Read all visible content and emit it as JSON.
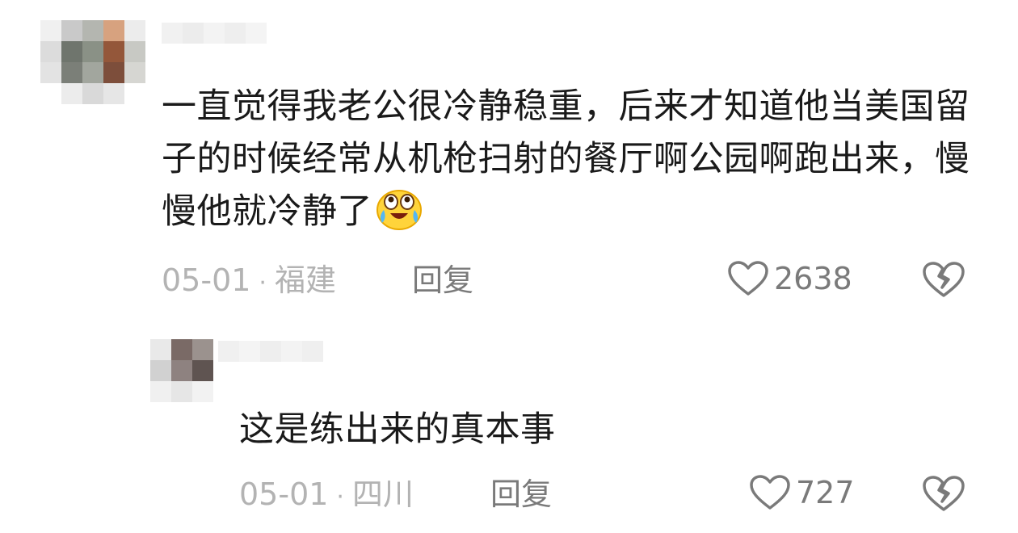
{
  "colors": {
    "text": "#1a1a1a",
    "meta": "#b3b3b3",
    "action": "#7a7a7a"
  },
  "comments": [
    {
      "text": "一直觉得我老公很冷静稳重，后来才知道他当美国留子的时候经常从机枪扫射的餐厅啊公园啊跑出来，慢慢他就冷静了",
      "emoji": "laugh-cry-emoji",
      "date": "05-01",
      "location": "福建",
      "reply_label": "回复",
      "likes": "2638"
    },
    {
      "text": "这是练出来的真本事",
      "date": "05-01",
      "location": "四川",
      "reply_label": "回复",
      "likes": "727"
    }
  ],
  "separator": "·"
}
